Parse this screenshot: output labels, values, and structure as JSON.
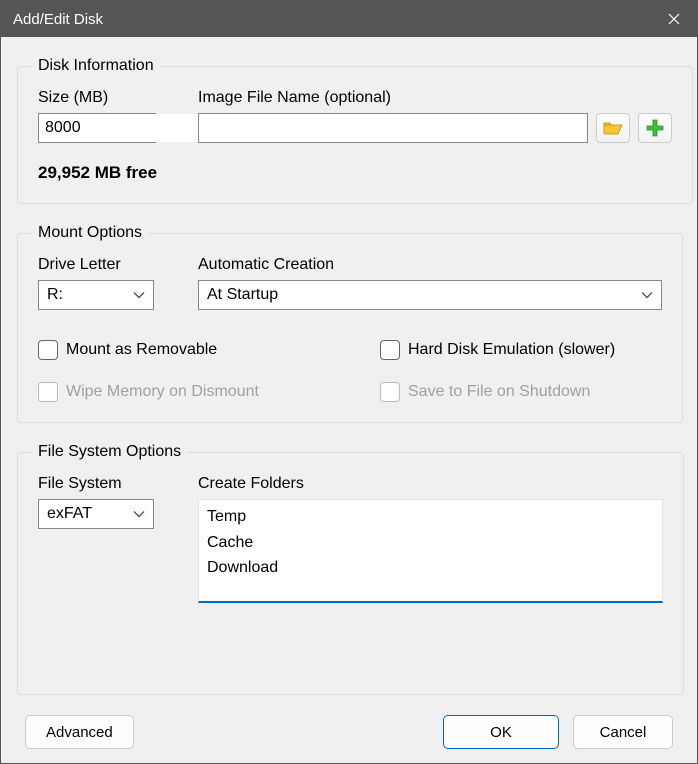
{
  "window": {
    "title": "Add/Edit Disk"
  },
  "disk_info": {
    "legend": "Disk Information",
    "size_label": "Size (MB)",
    "size_value": "8000",
    "image_label": "Image File Name (optional)",
    "image_value": "",
    "free_text": "29,952 MB free"
  },
  "mount": {
    "legend": "Mount Options",
    "drive_letter_label": "Drive Letter",
    "drive_letter_value": "R:",
    "auto_creation_label": "Automatic Creation",
    "auto_creation_value": "At Startup",
    "mount_removable": "Mount as Removable",
    "hard_disk_emu": "Hard Disk Emulation (slower)",
    "wipe_memory": "Wipe Memory on Dismount",
    "save_to_file": "Save to File on Shutdown"
  },
  "fs": {
    "legend": "File System Options",
    "fs_label": "File System",
    "fs_value": "exFAT",
    "folders_label": "Create Folders",
    "folders_value": "Temp\nCache\nDownload"
  },
  "buttons": {
    "advanced": "Advanced",
    "ok": "OK",
    "cancel": "Cancel"
  }
}
